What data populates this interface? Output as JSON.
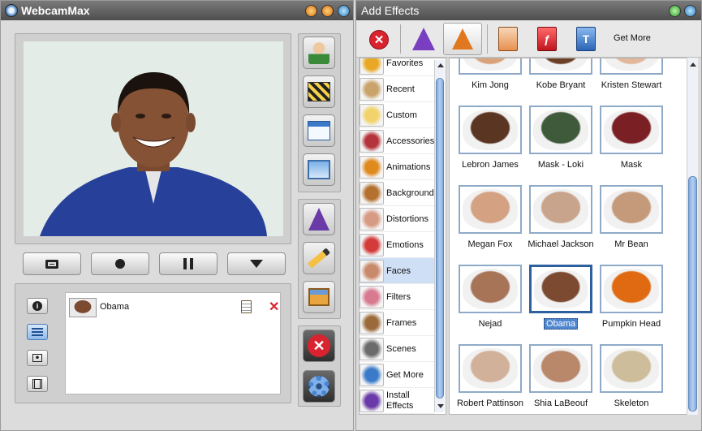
{
  "app": {
    "title": "WebcamMax"
  },
  "effects_window": {
    "title": "Add Effects"
  },
  "toolbar": {
    "get_more": "Get More"
  },
  "active_effect": {
    "name": "Obama"
  },
  "categories": [
    {
      "label": "Favorites",
      "icon": "star-icon",
      "color": "#e9a824"
    },
    {
      "label": "Recent",
      "icon": "clock-icon",
      "color": "#c9a36a"
    },
    {
      "label": "Custom",
      "icon": "folder-icon",
      "color": "#f2d36b"
    },
    {
      "label": "Accessories",
      "icon": "cap-icon",
      "color": "#b5333a"
    },
    {
      "label": "Animations",
      "icon": "butterfly-icon",
      "color": "#e08a1e"
    },
    {
      "label": "Background",
      "icon": "landscape-icon",
      "color": "#b3702e"
    },
    {
      "label": "Distortions",
      "icon": "distorted-face-icon",
      "color": "#d79a83"
    },
    {
      "label": "Emotions",
      "icon": "emotion-face-icon",
      "color": "#d33a3a"
    },
    {
      "label": "Faces",
      "icon": "face-icon",
      "color": "#c98a6b"
    },
    {
      "label": "Filters",
      "icon": "filter-icon",
      "color": "#d77a8f"
    },
    {
      "label": "Frames",
      "icon": "frame-icon",
      "color": "#9b6a3a"
    },
    {
      "label": "Scenes",
      "icon": "scene-icon",
      "color": "#6b6b6b"
    },
    {
      "label": "Get More",
      "icon": "globe-icon",
      "color": "#3a7ac8"
    },
    {
      "label": "Install Effects",
      "icon": "wizard-hat-icon",
      "color": "#6a3aa8"
    }
  ],
  "effects": [
    {
      "label": "Kim Jong",
      "color": "#d9a27a"
    },
    {
      "label": "Kobe Bryant",
      "color": "#6b3f25"
    },
    {
      "label": "Kristen Stewart",
      "color": "#e2b79a"
    },
    {
      "label": "Lebron James",
      "color": "#5a3522"
    },
    {
      "label": "Mask - Loki",
      "color": "#3f5a3a"
    },
    {
      "label": "Mask",
      "color": "#7a1f24"
    },
    {
      "label": "Megan Fox",
      "color": "#d4a283"
    },
    {
      "label": "Michael Jackson",
      "color": "#c9a48c"
    },
    {
      "label": "Mr Bean",
      "color": "#c49a7a"
    },
    {
      "label": "Nejad",
      "color": "#a87458"
    },
    {
      "label": "Obama",
      "color": "#7b4a30"
    },
    {
      "label": "Pumpkin Head",
      "color": "#e06a12"
    },
    {
      "label": "Robert Pattinson",
      "color": "#d2b19b"
    },
    {
      "label": "Shia LaBeouf",
      "color": "#b9876a"
    },
    {
      "label": "Skeleton",
      "color": "#cdbd9a"
    }
  ],
  "colors": {
    "selection": "#4f86d0",
    "tile_border": "#8faac8",
    "close_red": "#d9232e"
  }
}
